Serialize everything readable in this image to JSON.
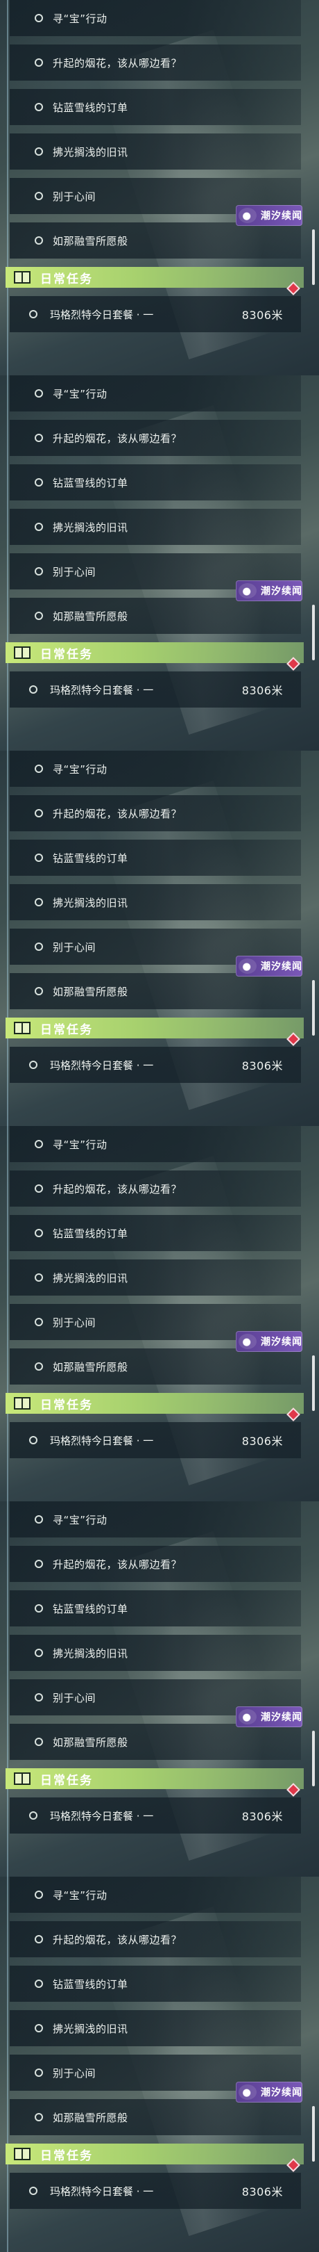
{
  "quests": [
    "寻“宝”行动",
    "升起的烟花，该从哪边看？",
    "钻蓝雪线的订单",
    "拂光搁浅的旧讯",
    "别于心间",
    "如那融雪所愿般"
  ],
  "region_tag": "潮汐续闻",
  "daily": {
    "title": "日常任务",
    "quest": "玛格烈特今日套餐 · 一",
    "distance": "8306米"
  },
  "colors": {
    "daily_bar": "#b6dc72",
    "tag_bg": "#6a4aa8",
    "marker": "#e0384a"
  }
}
